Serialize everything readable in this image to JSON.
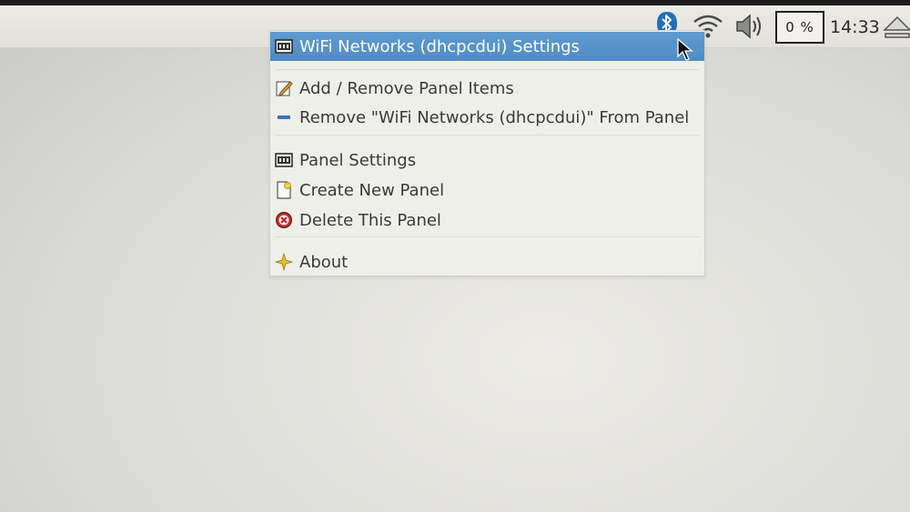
{
  "panel": {
    "tray_icons": [
      "bluetooth-icon",
      "wifi-icon",
      "volume-icon"
    ],
    "cpu_monitor": "0 %",
    "clock": "14:33",
    "eject_icon": "eject-icon"
  },
  "context_menu": {
    "items": [
      {
        "label": "WiFi Networks (dhcpcdui) Settings",
        "icon": "panel-settings-icon",
        "selected": true
      },
      {
        "label": "Add / Remove Panel Items",
        "icon": "edit-icon"
      },
      {
        "label": "Remove \"WiFi Networks (dhcpcdui)\" From Panel",
        "icon": "remove-icon"
      },
      {
        "label": "Panel Settings",
        "icon": "panel-settings-icon"
      },
      {
        "label": "Create New Panel",
        "icon": "new-document-icon"
      },
      {
        "label": "Delete This Panel",
        "icon": "delete-icon"
      },
      {
        "label": "About",
        "icon": "about-star-icon"
      }
    ]
  },
  "colors": {
    "selection": "#5f9bd1",
    "menu_bg": "#eeefe9",
    "panel_bg": "#e6e5e0",
    "bluetooth": "#1f6fb8",
    "delete": "#c0282a",
    "about": "#d9b42a"
  }
}
